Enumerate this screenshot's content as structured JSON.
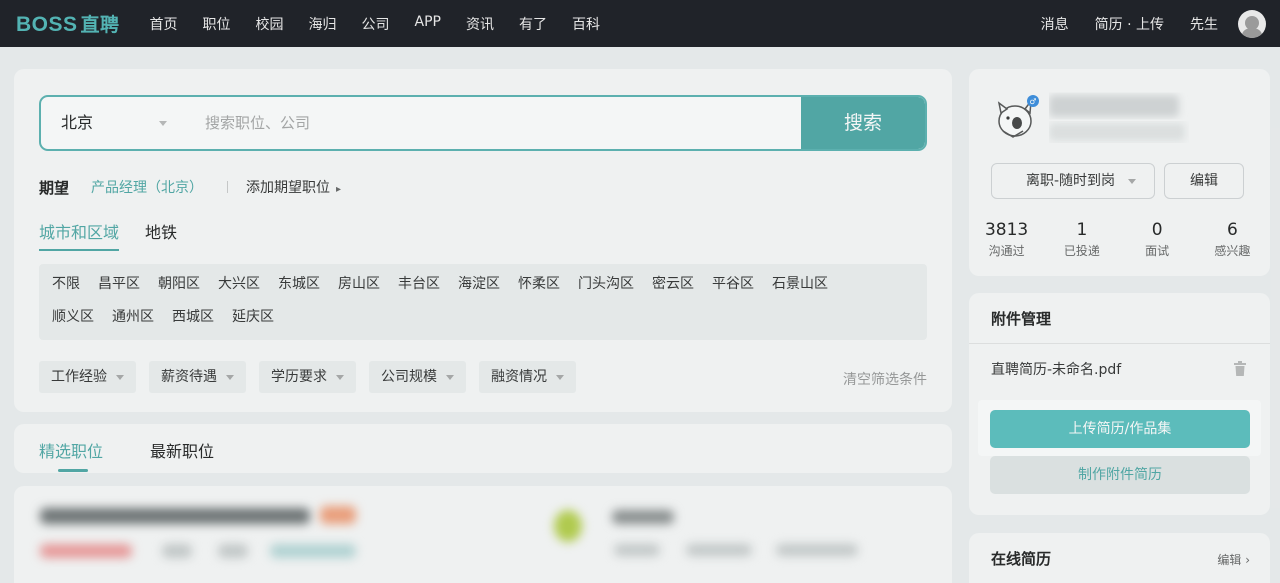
{
  "nav": {
    "logo_latin": "BOSS",
    "logo_cn": "直聘",
    "items": [
      "首页",
      "职位",
      "校园",
      "海归",
      "公司",
      "APP",
      "资讯",
      "有了",
      "百科"
    ],
    "messages": "消息",
    "resume_upload": "简历 · 上传",
    "user": "先生"
  },
  "search": {
    "city": "北京",
    "placeholder": "搜索职位、公司",
    "button": "搜索"
  },
  "expect": {
    "label": "期望",
    "job": "产品经理（北京）",
    "add": "添加期望职位"
  },
  "region_tabs": {
    "active": "城市和区域",
    "other": "地铁"
  },
  "districts": [
    "不限",
    "昌平区",
    "朝阳区",
    "大兴区",
    "东城区",
    "房山区",
    "丰台区",
    "海淀区",
    "怀柔区",
    "门头沟区",
    "密云区",
    "平谷区",
    "石景山区",
    "顺义区",
    "通州区",
    "西城区",
    "延庆区"
  ],
  "filters": [
    "工作经验",
    "薪资待遇",
    "学历要求",
    "公司规模",
    "融资情况"
  ],
  "clear_filters": "清空筛选条件",
  "job_tabs": {
    "active": "精选职位",
    "other": "最新职位"
  },
  "profile": {
    "status": "离职-随时到岗",
    "edit": "编辑",
    "stats": [
      {
        "num": "3813",
        "label": "沟通过"
      },
      {
        "num": "1",
        "label": "已投递"
      },
      {
        "num": "0",
        "label": "面试"
      },
      {
        "num": "6",
        "label": "感兴趣"
      }
    ]
  },
  "attachments": {
    "title": "附件管理",
    "file": "直聘简历-未命名.pdf",
    "upload": "上传简历/作品集",
    "make": "制作附件简历"
  },
  "online_resume": {
    "title": "在线简历",
    "edit": "编辑"
  },
  "colors": {
    "accent": "#4fa9a6",
    "nav_bg": "#202329",
    "upload_btn": "#5bc0bf"
  }
}
